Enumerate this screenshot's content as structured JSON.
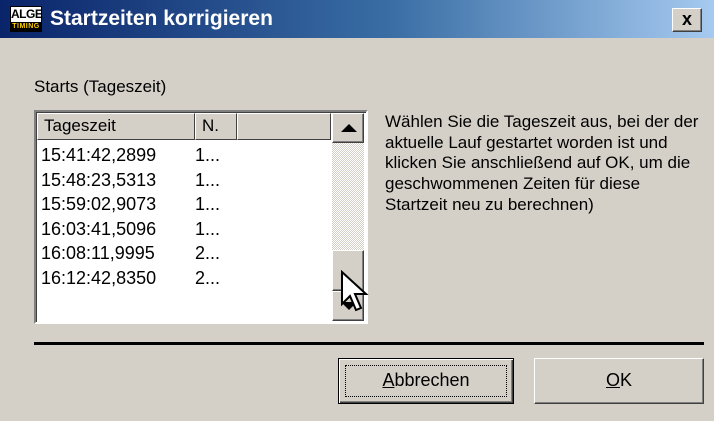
{
  "window": {
    "logo_top": "ALGE",
    "logo_bottom": "TIMING",
    "title": "Startzeiten korrigieren",
    "close_label": "x"
  },
  "group_label": "Starts (Tageszeit)",
  "list": {
    "columns": [
      "Tageszeit",
      "N.",
      ""
    ],
    "rows": [
      {
        "time": "15:41:42,2899",
        "n": "1..."
      },
      {
        "time": "15:48:23,5313",
        "n": "1..."
      },
      {
        "time": "15:59:02,9073",
        "n": "1..."
      },
      {
        "time": "16:03:41,5096",
        "n": "1..."
      },
      {
        "time": "16:08:11,9995",
        "n": "2..."
      },
      {
        "time": "16:12:42,8350",
        "n": "2..."
      }
    ]
  },
  "instructions": "Wählen Sie die Tageszeit aus, bei der der aktuelle Lauf gestartet worden ist und klicken Sie anschließend auf OK, um die geschwommenen Zeiten für diese Startzeit neu zu berechnen)",
  "buttons": {
    "cancel_mnemonic": "A",
    "cancel_rest": "bbrechen",
    "ok_mnemonic": "O",
    "ok_rest": "K"
  }
}
